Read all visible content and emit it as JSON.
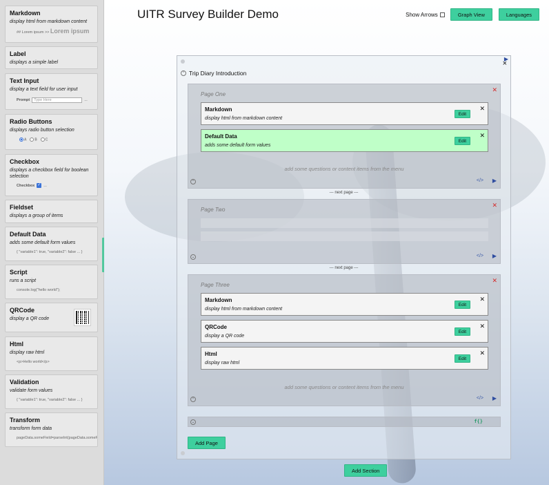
{
  "sidebar": {
    "items": [
      {
        "title": "Markdown",
        "desc": "display html from markdown content",
        "sample": "## Lorem ipsum >>",
        "sample_big": "Lorem ipsum"
      },
      {
        "title": "Label",
        "desc": "displays a simple label"
      },
      {
        "title": "Text Input",
        "desc": "display a text field for user input",
        "prompt": "Prompt",
        "placeholder": "Type Here",
        "ellipsis": "..."
      },
      {
        "title": "Radio Buttons",
        "desc": "displays radio button selection",
        "options": [
          "A",
          "B",
          "C"
        ]
      },
      {
        "title": "Checkbox",
        "desc": "displays a checkbox field for boolean selection",
        "label": "Checkbox",
        "ellipsis": "..."
      },
      {
        "title": "Fieldset",
        "desc": "displays a group of items"
      },
      {
        "title": "Default Data",
        "desc": "adds some default form values",
        "sample": "{ \"variable1\": true, \"variable2\": false ... }"
      },
      {
        "title": "Script",
        "desc": "runs a script",
        "sample": "console.log(\"hello world\");"
      },
      {
        "title": "QRCode",
        "desc": "display a QR code"
      },
      {
        "title": "Html",
        "desc": "display raw html",
        "sample": "<p>Hello world</p>"
      },
      {
        "title": "Validation",
        "desc": "validate form values",
        "sample": "{ \"variable1\": true, \"variable2\": false ... }"
      },
      {
        "title": "Transform",
        "desc": "transform form data",
        "sample": "pageData.someField=parseInt(pageData.someField);"
      }
    ]
  },
  "header": {
    "title": "UITR Survey Builder Demo",
    "show_arrows_label": "Show Arrows",
    "graph_view_label": "Graph View",
    "languages_label": "Languages"
  },
  "section": {
    "title": "Trip Diary Introduction",
    "close_glyph": "×",
    "pages": [
      {
        "title": "Page One",
        "items": [
          {
            "title": "Markdown",
            "desc": "display html from markdown content",
            "highlighted": false
          },
          {
            "title": "Default Data",
            "desc": "adds some default form values",
            "highlighted": true
          }
        ],
        "placeholder": "add some questions or content items from the menu"
      },
      {
        "title": "Page Two",
        "items": []
      },
      {
        "title": "Page Three",
        "items": [
          {
            "title": "Markdown",
            "desc": "display html from markdown content",
            "highlighted": false
          },
          {
            "title": "QRCode",
            "desc": "display a QR code",
            "highlighted": false
          },
          {
            "title": "Html",
            "desc": "display raw html",
            "highlighted": false
          }
        ],
        "placeholder": "add some questions or content items from the menu"
      }
    ],
    "next_page_label": "--- next page ---",
    "edit_label": "Edit",
    "code_glyph": "</>",
    "fx_glyph": "f{}",
    "add_page_label": "Add Page"
  },
  "add_section_label": "Add Section",
  "colors": {
    "accent_green": "#3ecf9e",
    "highlight_item": "#bfffc8",
    "delete_red": "#d42a2a"
  }
}
